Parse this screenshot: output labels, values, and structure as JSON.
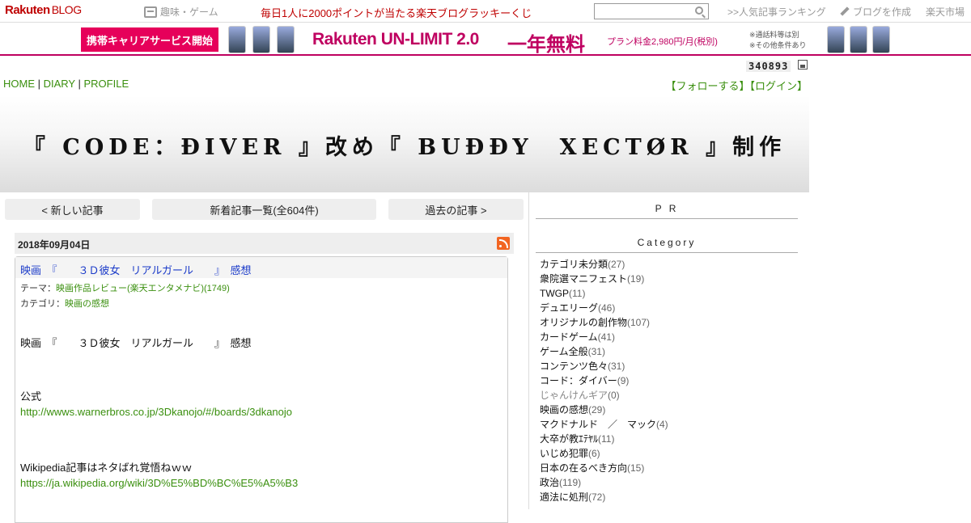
{
  "topbar": {
    "logo_main": "Rakuten",
    "logo_blog": "BLOG",
    "hobby_label": "趣味・ゲーム",
    "lucky_text": "毎日1人に2000ポイントが当たる楽天ブログラッキーくじ",
    "search_placeholder": "",
    "ranking_link": ">>人気記事ランキング",
    "create_blog": "ブログを作成",
    "ichiba": "楽天市場"
  },
  "banner": {
    "carrier_button": "携帯キャリアサービス開始",
    "unlimit_brand": "Rakuten",
    "unlimit_name": " UN-LIMIT 2.0",
    "free_text": "一年無料",
    "price_text": "プラン料金2,980円/月(税別)",
    "note1": "※通話料等は別",
    "note2": "※その他条件あり"
  },
  "counter": "340893",
  "nav": {
    "home": "HOME",
    "diary": "DIARY",
    "profile": "PROFILE",
    "sep": " | ",
    "follow": "【フォローする】",
    "login": "【ログイン】"
  },
  "blog_title": "『 CODE：ÐIVER 』改め『 BUÐÐY　XECTØR 』制作",
  "pager": {
    "newer": "< 新しい記事",
    "list": "新着記事一覧(全604件)",
    "older": "過去の記事 >"
  },
  "article": {
    "date": "2018年09月04日",
    "title": "映画　『　　３Ｄ彼女　リアルガール　　』　感想",
    "theme_label": "テーマ：",
    "theme_value": "映画作品レビュー(楽天エンタメナビ)(1749)",
    "category_label": "カテゴリ：",
    "category_value": "映画の感想",
    "body_heading": "映画　『　　３Ｄ彼女　リアルガール　　』　感想",
    "official_label": "公式",
    "official_link": "http://wwws.warnerbros.co.jp/3Dkanojo/#/boards/3dkanojo",
    "wiki_label": "Wikipedia記事はネタばれ覚悟ねｗｗ",
    "wiki_link": "https://ja.wikipedia.org/wiki/3D%E5%BD%BC%E5%A5%B3"
  },
  "sidebar": {
    "pr_head": "P R",
    "category_head": "Category",
    "categories": [
      {
        "name": "カテゴリ未分類",
        "count": "(27)"
      },
      {
        "name": "衆院選マニフェスト",
        "count": "(19)"
      },
      {
        "name": "TWGP",
        "count": "(11)"
      },
      {
        "name": "デュエリーグ",
        "count": "(46)"
      },
      {
        "name": "オリジナルの創作物",
        "count": "(107)"
      },
      {
        "name": "カードゲーム",
        "count": "(41)"
      },
      {
        "name": "ゲーム全般",
        "count": "(31)"
      },
      {
        "name": "コンテンツ色々",
        "count": "(31)"
      },
      {
        "name": "コード：ダイバー",
        "count": "(9)"
      },
      {
        "name": "じゃんけんギア",
        "count": "(0)"
      },
      {
        "name": "映画の感想",
        "count": "(29)"
      },
      {
        "name": "マクドナルド　／　マック",
        "count": "(4)"
      },
      {
        "name": "大卒が教ｴﾃﾔﾙ",
        "count": "(11)"
      },
      {
        "name": "いじめ犯罪",
        "count": "(6)"
      },
      {
        "name": "日本の在るべき方向",
        "count": "(15)"
      },
      {
        "name": "政治",
        "count": "(119)"
      },
      {
        "name": "適法に処刑",
        "count": "(72)"
      }
    ]
  },
  "colors": {
    "brand_red": "#bf0000",
    "pink": "#e6005a",
    "link_green": "#3a8f0e",
    "title_blue": "#1a3ac9"
  }
}
